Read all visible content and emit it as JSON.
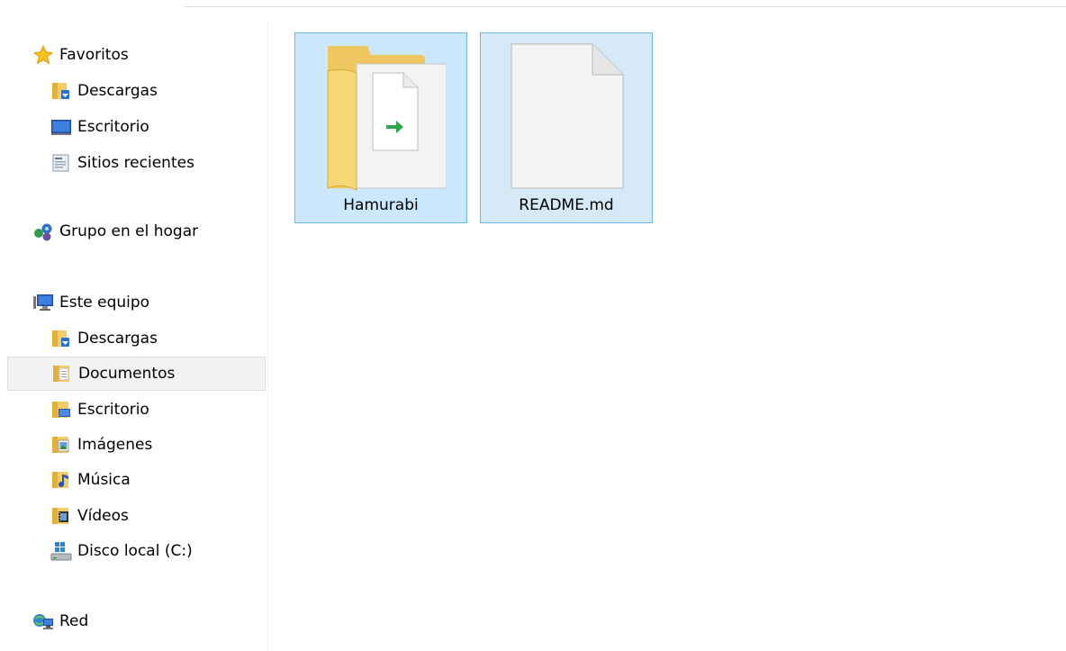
{
  "navigation": {
    "favorites": {
      "label": "Favoritos",
      "items": [
        {
          "label": "Descargas",
          "icon": "downloads-folder-icon"
        },
        {
          "label": "Escritorio",
          "icon": "desktop-icon"
        },
        {
          "label": "Sitios recientes",
          "icon": "recent-places-icon"
        }
      ]
    },
    "homegroup": {
      "label": "Grupo en el hogar",
      "icon": "homegroup-icon"
    },
    "this_pc": {
      "label": "Este equipo",
      "items": [
        {
          "label": "Descargas",
          "icon": "downloads-folder-icon"
        },
        {
          "label": "Documentos",
          "icon": "documents-folder-icon",
          "selected": true
        },
        {
          "label": "Escritorio",
          "icon": "desktop-folder-icon"
        },
        {
          "label": "Imágenes",
          "icon": "pictures-folder-icon"
        },
        {
          "label": "Música",
          "icon": "music-folder-icon"
        },
        {
          "label": "Vídeos",
          "icon": "videos-folder-icon"
        },
        {
          "label": "Disco local (C:)",
          "icon": "local-disk-icon"
        }
      ]
    },
    "network": {
      "label": "Red",
      "icon": "network-icon"
    }
  },
  "files": [
    {
      "name": "Hamurabi",
      "type": "folder",
      "selected": true
    },
    {
      "name": "README.md",
      "type": "file",
      "selected": true
    }
  ],
  "colors": {
    "selection_border": "#6cb8e6",
    "selection_fill": "#cce8ff",
    "nav_selected_fill": "#f2f2f2"
  }
}
